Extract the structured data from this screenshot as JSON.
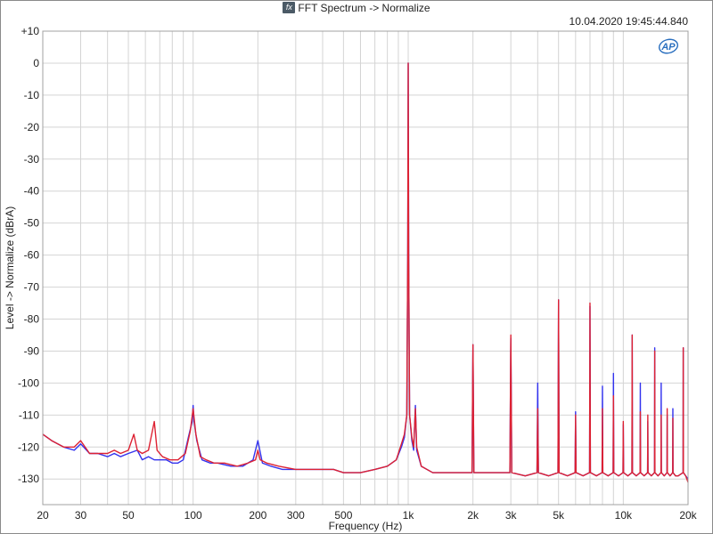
{
  "header": {
    "fx_icon_text": "fx",
    "title": "FFT Spectrum -> Normalize",
    "timestamp": "10.04.2020 19:45:44.840",
    "logo_text": "AP"
  },
  "colors": {
    "series_blue": "#3333ee",
    "series_red": "#dd2233",
    "grid": "#d4d4d4",
    "plot_border": "#a0a0a0",
    "logo": "#2a6fbf"
  },
  "chart_data": {
    "type": "line",
    "xlabel": "Frequency (Hz)",
    "ylabel": "Level -> Normalize (dBrA)",
    "x_scale": "log",
    "xlim": [
      20,
      20000
    ],
    "ylim": [
      -138,
      10
    ],
    "grid": true,
    "x_ticks": [
      {
        "value": 20,
        "label": "20"
      },
      {
        "value": 30,
        "label": "30"
      },
      {
        "value": 50,
        "label": "50"
      },
      {
        "value": 100,
        "label": "100"
      },
      {
        "value": 200,
        "label": "200"
      },
      {
        "value": 300,
        "label": "300"
      },
      {
        "value": 500,
        "label": "500"
      },
      {
        "value": 1000,
        "label": "1k"
      },
      {
        "value": 2000,
        "label": "2k"
      },
      {
        "value": 3000,
        "label": "3k"
      },
      {
        "value": 5000,
        "label": "5k"
      },
      {
        "value": 10000,
        "label": "10k"
      },
      {
        "value": 20000,
        "label": "20k"
      }
    ],
    "y_ticks": [
      {
        "value": 10,
        "label": "+10"
      },
      {
        "value": 0,
        "label": "0"
      },
      {
        "value": -10,
        "label": "-10"
      },
      {
        "value": -20,
        "label": "-20"
      },
      {
        "value": -30,
        "label": "-30"
      },
      {
        "value": -40,
        "label": "-40"
      },
      {
        "value": -50,
        "label": "-50"
      },
      {
        "value": -60,
        "label": "-60"
      },
      {
        "value": -70,
        "label": "-70"
      },
      {
        "value": -80,
        "label": "-80"
      },
      {
        "value": -90,
        "label": "-90"
      },
      {
        "value": -100,
        "label": "-100"
      },
      {
        "value": -110,
        "label": "-110"
      },
      {
        "value": -120,
        "label": "-120"
      },
      {
        "value": -130,
        "label": "-130"
      }
    ],
    "series": [
      {
        "color": "#3333ee",
        "points": [
          [
            20,
            -116
          ],
          [
            22,
            -118
          ],
          [
            25,
            -120
          ],
          [
            28,
            -121
          ],
          [
            30,
            -119
          ],
          [
            33,
            -122
          ],
          [
            36,
            -122
          ],
          [
            40,
            -123
          ],
          [
            43,
            -122
          ],
          [
            46,
            -123
          ],
          [
            50,
            -122
          ],
          [
            55,
            -121
          ],
          [
            58,
            -124
          ],
          [
            62,
            -123
          ],
          [
            66,
            -124
          ],
          [
            70,
            -124
          ],
          [
            75,
            -124
          ],
          [
            80,
            -125
          ],
          [
            85,
            -125
          ],
          [
            90,
            -124
          ],
          [
            95,
            -117
          ],
          [
            99,
            -112
          ],
          [
            100,
            -107
          ],
          [
            101,
            -112
          ],
          [
            104,
            -118
          ],
          [
            110,
            -124
          ],
          [
            120,
            -125
          ],
          [
            130,
            -125
          ],
          [
            150,
            -126
          ],
          [
            170,
            -126
          ],
          [
            190,
            -124
          ],
          [
            200,
            -118
          ],
          [
            210,
            -125
          ],
          [
            230,
            -126
          ],
          [
            260,
            -127
          ],
          [
            300,
            -127
          ],
          [
            350,
            -127
          ],
          [
            400,
            -127
          ],
          [
            450,
            -127
          ],
          [
            500,
            -128
          ],
          [
            550,
            -128
          ],
          [
            600,
            -128
          ],
          [
            700,
            -127
          ],
          [
            800,
            -126
          ],
          [
            880,
            -124
          ],
          [
            930,
            -120
          ],
          [
            960,
            -117
          ],
          [
            985,
            -110
          ],
          [
            995,
            -60
          ],
          [
            1000,
            0
          ],
          [
            1005,
            -60
          ],
          [
            1015,
            -110
          ],
          [
            1040,
            -118
          ],
          [
            1060,
            -121
          ],
          [
            1080,
            -107
          ],
          [
            1095,
            -121
          ],
          [
            1150,
            -126
          ],
          [
            1300,
            -128
          ],
          [
            1500,
            -128
          ],
          [
            1800,
            -128
          ],
          [
            1980,
            -128
          ],
          [
            2000,
            -88
          ],
          [
            2020,
            -128
          ],
          [
            2300,
            -128
          ],
          [
            2800,
            -128
          ],
          [
            2970,
            -128
          ],
          [
            3000,
            -86
          ],
          [
            3030,
            -128
          ],
          [
            3500,
            -129
          ],
          [
            3970,
            -128
          ],
          [
            4000,
            -100
          ],
          [
            4030,
            -128
          ],
          [
            4500,
            -129
          ],
          [
            4970,
            -128
          ],
          [
            5000,
            -74
          ],
          [
            5030,
            -128
          ],
          [
            5500,
            -129
          ],
          [
            5970,
            -128
          ],
          [
            6000,
            -109
          ],
          [
            6030,
            -128
          ],
          [
            6500,
            -129
          ],
          [
            6970,
            -128
          ],
          [
            7000,
            -76
          ],
          [
            7030,
            -128
          ],
          [
            7500,
            -129
          ],
          [
            7970,
            -128
          ],
          [
            8000,
            -101
          ],
          [
            8030,
            -128
          ],
          [
            8500,
            -129
          ],
          [
            8970,
            -128
          ],
          [
            9000,
            -97
          ],
          [
            9030,
            -128
          ],
          [
            9500,
            -129
          ],
          [
            9970,
            -128
          ],
          [
            10000,
            -113
          ],
          [
            10030,
            -128
          ],
          [
            10500,
            -129
          ],
          [
            10970,
            -128
          ],
          [
            11000,
            -85
          ],
          [
            11030,
            -128
          ],
          [
            11500,
            -129
          ],
          [
            11970,
            -128
          ],
          [
            12000,
            -100
          ],
          [
            12030,
            -128
          ],
          [
            12500,
            -129
          ],
          [
            12970,
            -128
          ],
          [
            13000,
            -112
          ],
          [
            13030,
            -128
          ],
          [
            13500,
            -129
          ],
          [
            13970,
            -128
          ],
          [
            14000,
            -89
          ],
          [
            14030,
            -128
          ],
          [
            14500,
            -129
          ],
          [
            14970,
            -128
          ],
          [
            15000,
            -100
          ],
          [
            15030,
            -128
          ],
          [
            15500,
            -129
          ],
          [
            15970,
            -128
          ],
          [
            16000,
            -110
          ],
          [
            16030,
            -128
          ],
          [
            16500,
            -129
          ],
          [
            16970,
            -128
          ],
          [
            17000,
            -108
          ],
          [
            17030,
            -128
          ],
          [
            17500,
            -129
          ],
          [
            18000,
            -129
          ],
          [
            18970,
            -128
          ],
          [
            19000,
            -89
          ],
          [
            19030,
            -128
          ],
          [
            19500,
            -129
          ],
          [
            20000,
            -130
          ]
        ]
      },
      {
        "color": "#dd2233",
        "points": [
          [
            20,
            -116
          ],
          [
            22,
            -118
          ],
          [
            25,
            -120
          ],
          [
            28,
            -120
          ],
          [
            30,
            -118
          ],
          [
            33,
            -122
          ],
          [
            36,
            -122
          ],
          [
            40,
            -122
          ],
          [
            43,
            -121
          ],
          [
            46,
            -122
          ],
          [
            50,
            -121
          ],
          [
            53,
            -116
          ],
          [
            55,
            -121
          ],
          [
            58,
            -122
          ],
          [
            62,
            -121
          ],
          [
            66,
            -112
          ],
          [
            68,
            -121
          ],
          [
            72,
            -123
          ],
          [
            78,
            -124
          ],
          [
            85,
            -124
          ],
          [
            92,
            -122
          ],
          [
            97,
            -115
          ],
          [
            100,
            -108
          ],
          [
            103,
            -116
          ],
          [
            108,
            -123
          ],
          [
            115,
            -124
          ],
          [
            125,
            -125
          ],
          [
            140,
            -125
          ],
          [
            160,
            -126
          ],
          [
            180,
            -125
          ],
          [
            195,
            -124
          ],
          [
            200,
            -121
          ],
          [
            205,
            -124
          ],
          [
            220,
            -125
          ],
          [
            250,
            -126
          ],
          [
            300,
            -127
          ],
          [
            350,
            -127
          ],
          [
            400,
            -127
          ],
          [
            450,
            -127
          ],
          [
            500,
            -128
          ],
          [
            550,
            -128
          ],
          [
            600,
            -128
          ],
          [
            700,
            -127
          ],
          [
            800,
            -126
          ],
          [
            880,
            -124
          ],
          [
            930,
            -119
          ],
          [
            960,
            -116
          ],
          [
            985,
            -110
          ],
          [
            995,
            -60
          ],
          [
            1000,
            0
          ],
          [
            1005,
            -60
          ],
          [
            1015,
            -110
          ],
          [
            1040,
            -117
          ],
          [
            1060,
            -120
          ],
          [
            1080,
            -108
          ],
          [
            1095,
            -120
          ],
          [
            1150,
            -126
          ],
          [
            1300,
            -128
          ],
          [
            1500,
            -128
          ],
          [
            1800,
            -128
          ],
          [
            1980,
            -128
          ],
          [
            2000,
            -88
          ],
          [
            2020,
            -128
          ],
          [
            2300,
            -128
          ],
          [
            2800,
            -128
          ],
          [
            2970,
            -128
          ],
          [
            3000,
            -85
          ],
          [
            3030,
            -128
          ],
          [
            3500,
            -129
          ],
          [
            3970,
            -128
          ],
          [
            4000,
            -108
          ],
          [
            4030,
            -128
          ],
          [
            4500,
            -129
          ],
          [
            4970,
            -128
          ],
          [
            5000,
            -74
          ],
          [
            5030,
            -128
          ],
          [
            5500,
            -129
          ],
          [
            5970,
            -128
          ],
          [
            6000,
            -110
          ],
          [
            6030,
            -128
          ],
          [
            6500,
            -129
          ],
          [
            6970,
            -128
          ],
          [
            7000,
            -75
          ],
          [
            7030,
            -128
          ],
          [
            7500,
            -129
          ],
          [
            7970,
            -128
          ],
          [
            8000,
            -108
          ],
          [
            8030,
            -128
          ],
          [
            8500,
            -129
          ],
          [
            8970,
            -128
          ],
          [
            9000,
            -104
          ],
          [
            9030,
            -128
          ],
          [
            9500,
            -129
          ],
          [
            9970,
            -128
          ],
          [
            10000,
            -112
          ],
          [
            10030,
            -128
          ],
          [
            10500,
            -129
          ],
          [
            10970,
            -128
          ],
          [
            11000,
            -85
          ],
          [
            11030,
            -128
          ],
          [
            11500,
            -129
          ],
          [
            11970,
            -128
          ],
          [
            12000,
            -109
          ],
          [
            12030,
            -128
          ],
          [
            12500,
            -129
          ],
          [
            12970,
            -128
          ],
          [
            13000,
            -110
          ],
          [
            13030,
            -128
          ],
          [
            13500,
            -129
          ],
          [
            13970,
            -128
          ],
          [
            14000,
            -90
          ],
          [
            14030,
            -128
          ],
          [
            14500,
            -129
          ],
          [
            14970,
            -128
          ],
          [
            15000,
            -110
          ],
          [
            15030,
            -128
          ],
          [
            15500,
            -129
          ],
          [
            15970,
            -128
          ],
          [
            16000,
            -108
          ],
          [
            16030,
            -128
          ],
          [
            16500,
            -129
          ],
          [
            16970,
            -128
          ],
          [
            17000,
            -111
          ],
          [
            17030,
            -128
          ],
          [
            17500,
            -129
          ],
          [
            18000,
            -129
          ],
          [
            18970,
            -128
          ],
          [
            19000,
            -89
          ],
          [
            19030,
            -128
          ],
          [
            19500,
            -129
          ],
          [
            20000,
            -131
          ]
        ]
      }
    ]
  }
}
